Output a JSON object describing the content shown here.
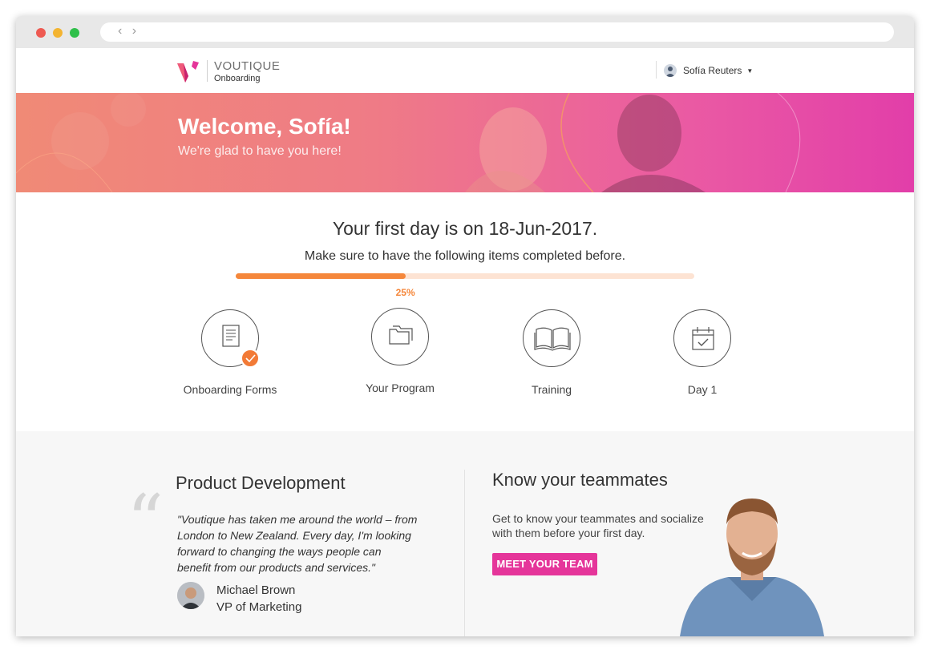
{
  "header": {
    "brand": "VOUTIQUE",
    "subbrand": "Onboarding",
    "user_name": "Sofía Reuters"
  },
  "hero": {
    "title": "Welcome, Sofía!",
    "subtitle": "We're glad to have you here!"
  },
  "checklist": {
    "first_day": "Your first day is on 18-Jun-2017.",
    "instruction": "Make sure to have the following items completed before.",
    "progress_value": 0.37,
    "progress_label": "25%",
    "steps": [
      {
        "label": "Onboarding Forms",
        "icon": "document-icon",
        "done": true
      },
      {
        "label": "Your Program",
        "icon": "folders-icon",
        "done": false
      },
      {
        "label": "Training",
        "icon": "book-icon",
        "done": false
      },
      {
        "label": "Day 1",
        "icon": "calendar-check-icon",
        "done": false
      }
    ]
  },
  "product_development": {
    "title": "Product Development",
    "quote": "\"Voutique has taken me around the world – from London to New Zealand. Every day, I'm looking forward to changing the ways people can benefit from our products and services.\"",
    "author_name": "Michael Brown",
    "author_role": "VP of Marketing",
    "carousel_active": 1
  },
  "teammates": {
    "title": "Know your teammates",
    "text": "Get to know your teammates and socialize with them before your first day.",
    "button_label": "MEET YOUR TEAM"
  },
  "colors": {
    "accent_orange": "#f5873b",
    "accent_pink": "#e5359a"
  }
}
